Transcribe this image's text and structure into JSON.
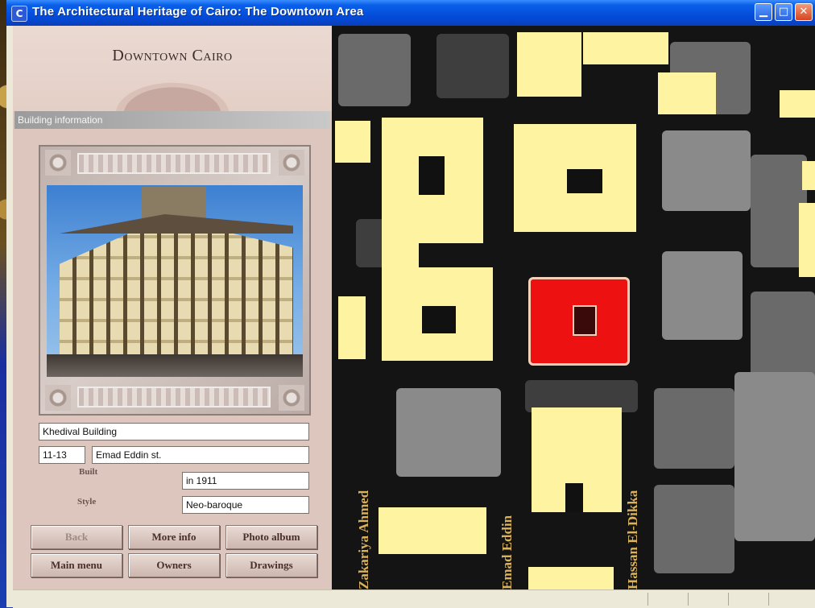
{
  "window": {
    "title": "The Architectural Heritage of Cairo: The Downtown Area",
    "app_icon": "app-icon",
    "controls": [
      "minimize",
      "maximize",
      "close"
    ]
  },
  "header": {
    "title": "Downtown Cairo"
  },
  "section": {
    "title": "Building information"
  },
  "building": {
    "name": "Khedival Building",
    "number": "11-13",
    "street": "Emad Eddin st.",
    "built_label": "Built",
    "built_value": "in 1911",
    "style_label": "Style",
    "style_value": "Neo-baroque"
  },
  "buttons": {
    "back": "Back",
    "more_info": "More info",
    "photo_album": "Photo album",
    "main_menu": "Main menu",
    "owners": "Owners",
    "drawings": "Drawings"
  },
  "map": {
    "street_labels": [
      "Zakariya Ahmed",
      "Emad Eddin",
      "Hassan El-Dikka"
    ],
    "colors": {
      "building": "#fdf3a0",
      "selected": "#ee1111",
      "background": "#141414"
    }
  }
}
